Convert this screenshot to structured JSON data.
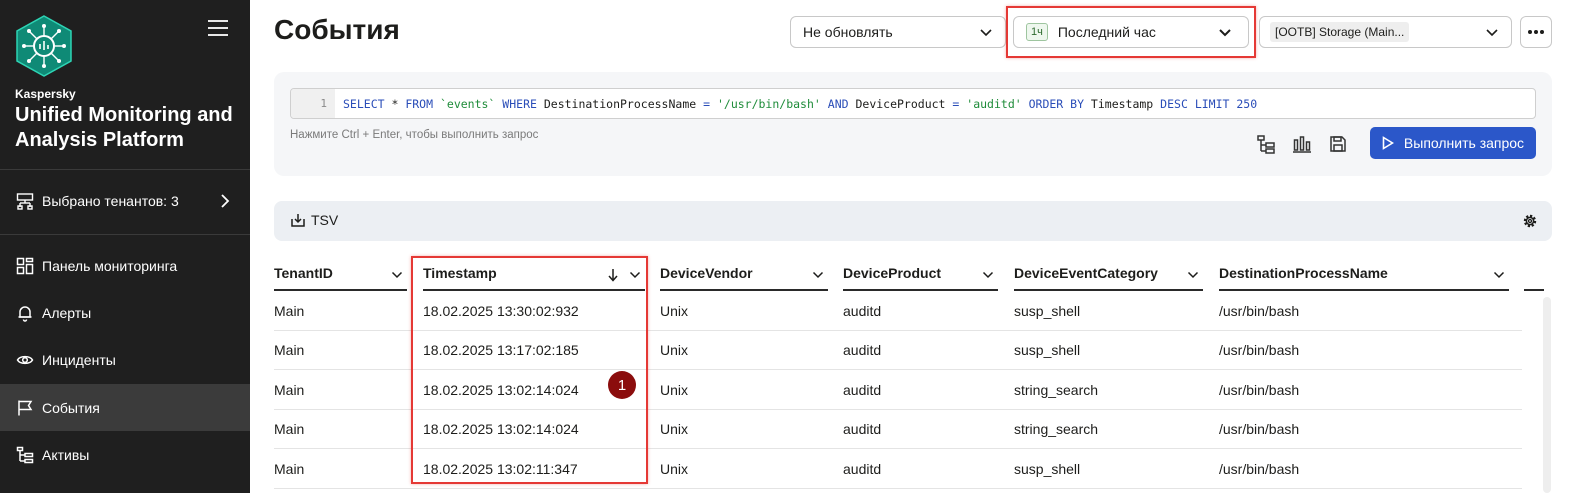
{
  "sidebar": {
    "brand": "Kaspersky",
    "product": "Unified Monitoring and Analysis Platform",
    "tenants_label": "Выбрано тенантов: 3",
    "items": [
      {
        "label": "Панель мониторинга",
        "icon": "dashboard-icon"
      },
      {
        "label": "Алерты",
        "icon": "bell-icon"
      },
      {
        "label": "Инциденты",
        "icon": "eye-icon"
      },
      {
        "label": "События",
        "icon": "flag-icon",
        "active": true
      },
      {
        "label": "Активы",
        "icon": "assets-tree-icon"
      }
    ]
  },
  "header": {
    "title": "События",
    "refresh_select": "Не обновлять",
    "period_badge": "1ч",
    "period_select": "Последний час",
    "storage_select": "[OOTB] Storage (Main..."
  },
  "query": {
    "line_number": "1",
    "tokens": [
      {
        "t": "SELECT",
        "c": "kw"
      },
      {
        "t": " * ",
        "c": "id"
      },
      {
        "t": "FROM",
        "c": "kw"
      },
      {
        "t": " ",
        "c": "id"
      },
      {
        "t": "`events`",
        "c": "str"
      },
      {
        "t": " ",
        "c": "id"
      },
      {
        "t": "WHERE",
        "c": "kw"
      },
      {
        "t": " DestinationProcessName ",
        "c": "id"
      },
      {
        "t": "=",
        "c": "kw"
      },
      {
        "t": " ",
        "c": "id"
      },
      {
        "t": "'/usr/bin/bash'",
        "c": "str"
      },
      {
        "t": " ",
        "c": "id"
      },
      {
        "t": "AND",
        "c": "kw"
      },
      {
        "t": " DeviceProduct ",
        "c": "id"
      },
      {
        "t": "=",
        "c": "kw"
      },
      {
        "t": " ",
        "c": "id"
      },
      {
        "t": "'auditd'",
        "c": "str"
      },
      {
        "t": " ",
        "c": "id"
      },
      {
        "t": "ORDER BY",
        "c": "kw"
      },
      {
        "t": " Timestamp ",
        "c": "id"
      },
      {
        "t": "DESC",
        "c": "kw"
      },
      {
        "t": " ",
        "c": "id"
      },
      {
        "t": "LIMIT",
        "c": "kw"
      },
      {
        "t": " ",
        "c": "id"
      },
      {
        "t": "250",
        "c": "kw"
      }
    ],
    "hint": "Нажмите Ctrl + Enter, чтобы выполнить запрос",
    "run_label": "Выполнить запрос"
  },
  "results": {
    "export_label": "TSV",
    "columns": [
      "TenantID",
      "Timestamp",
      "DeviceVendor",
      "DeviceProduct",
      "DeviceEventCategory",
      "DestinationProcessName"
    ],
    "rows": [
      [
        "Main",
        "18.02.2025 13:30:02:932",
        "Unix",
        "auditd",
        "susp_shell",
        "/usr/bin/bash"
      ],
      [
        "Main",
        "18.02.2025 13:17:02:185",
        "Unix",
        "auditd",
        "susp_shell",
        "/usr/bin/bash"
      ],
      [
        "Main",
        "18.02.2025 13:02:14:024",
        "Unix",
        "auditd",
        "string_search",
        "/usr/bin/bash"
      ],
      [
        "Main",
        "18.02.2025 13:02:14:024",
        "Unix",
        "auditd",
        "string_search",
        "/usr/bin/bash"
      ],
      [
        "Main",
        "18.02.2025 13:02:11:347",
        "Unix",
        "auditd",
        "susp_shell",
        "/usr/bin/bash"
      ]
    ],
    "annotation_marker": "1"
  },
  "colors": {
    "sidebar_bg": "#1f1f1f",
    "accent": "#2b57c9",
    "highlight": "#e53935",
    "marker": "#8b0d0d"
  }
}
